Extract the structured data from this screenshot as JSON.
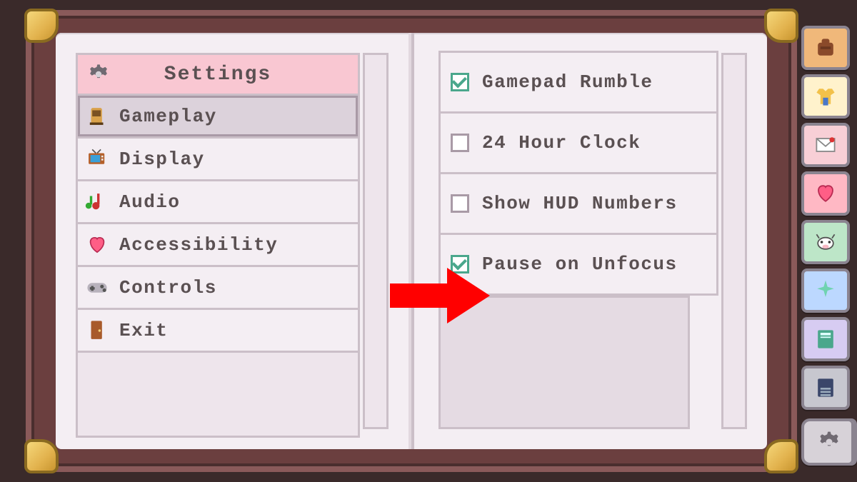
{
  "header": {
    "title": "Settings"
  },
  "menu": {
    "items": [
      {
        "id": "gameplay",
        "label": "Gameplay",
        "icon": "knight",
        "selected": true
      },
      {
        "id": "display",
        "label": "Display",
        "icon": "tv",
        "selected": false
      },
      {
        "id": "audio",
        "label": "Audio",
        "icon": "music",
        "selected": false
      },
      {
        "id": "accessibility",
        "label": "Accessibility",
        "icon": "heart",
        "selected": false
      },
      {
        "id": "controls",
        "label": "Controls",
        "icon": "gamepad",
        "selected": false
      },
      {
        "id": "exit",
        "label": "Exit",
        "icon": "door",
        "selected": false
      }
    ]
  },
  "options": [
    {
      "id": "rumble",
      "label": "Gamepad Rumble",
      "checked": true
    },
    {
      "id": "clock24",
      "label": "24 Hour Clock",
      "checked": false
    },
    {
      "id": "hudnum",
      "label": "Show HUD Numbers",
      "checked": false
    },
    {
      "id": "unfocus",
      "label": "Pause on Unfocus",
      "checked": true
    }
  ],
  "tabs": [
    {
      "id": "bag",
      "icon": "bag"
    },
    {
      "id": "shirt",
      "icon": "shirt"
    },
    {
      "id": "mail",
      "icon": "mail"
    },
    {
      "id": "heart",
      "icon": "heart"
    },
    {
      "id": "cow",
      "icon": "cow"
    },
    {
      "id": "spark",
      "icon": "sparkle"
    },
    {
      "id": "book",
      "icon": "book"
    },
    {
      "id": "journ",
      "icon": "journal"
    },
    {
      "id": "gear",
      "icon": "gear",
      "active": true
    }
  ],
  "annotation": {
    "arrow_target": "unfocus",
    "color": "#ff0000"
  }
}
